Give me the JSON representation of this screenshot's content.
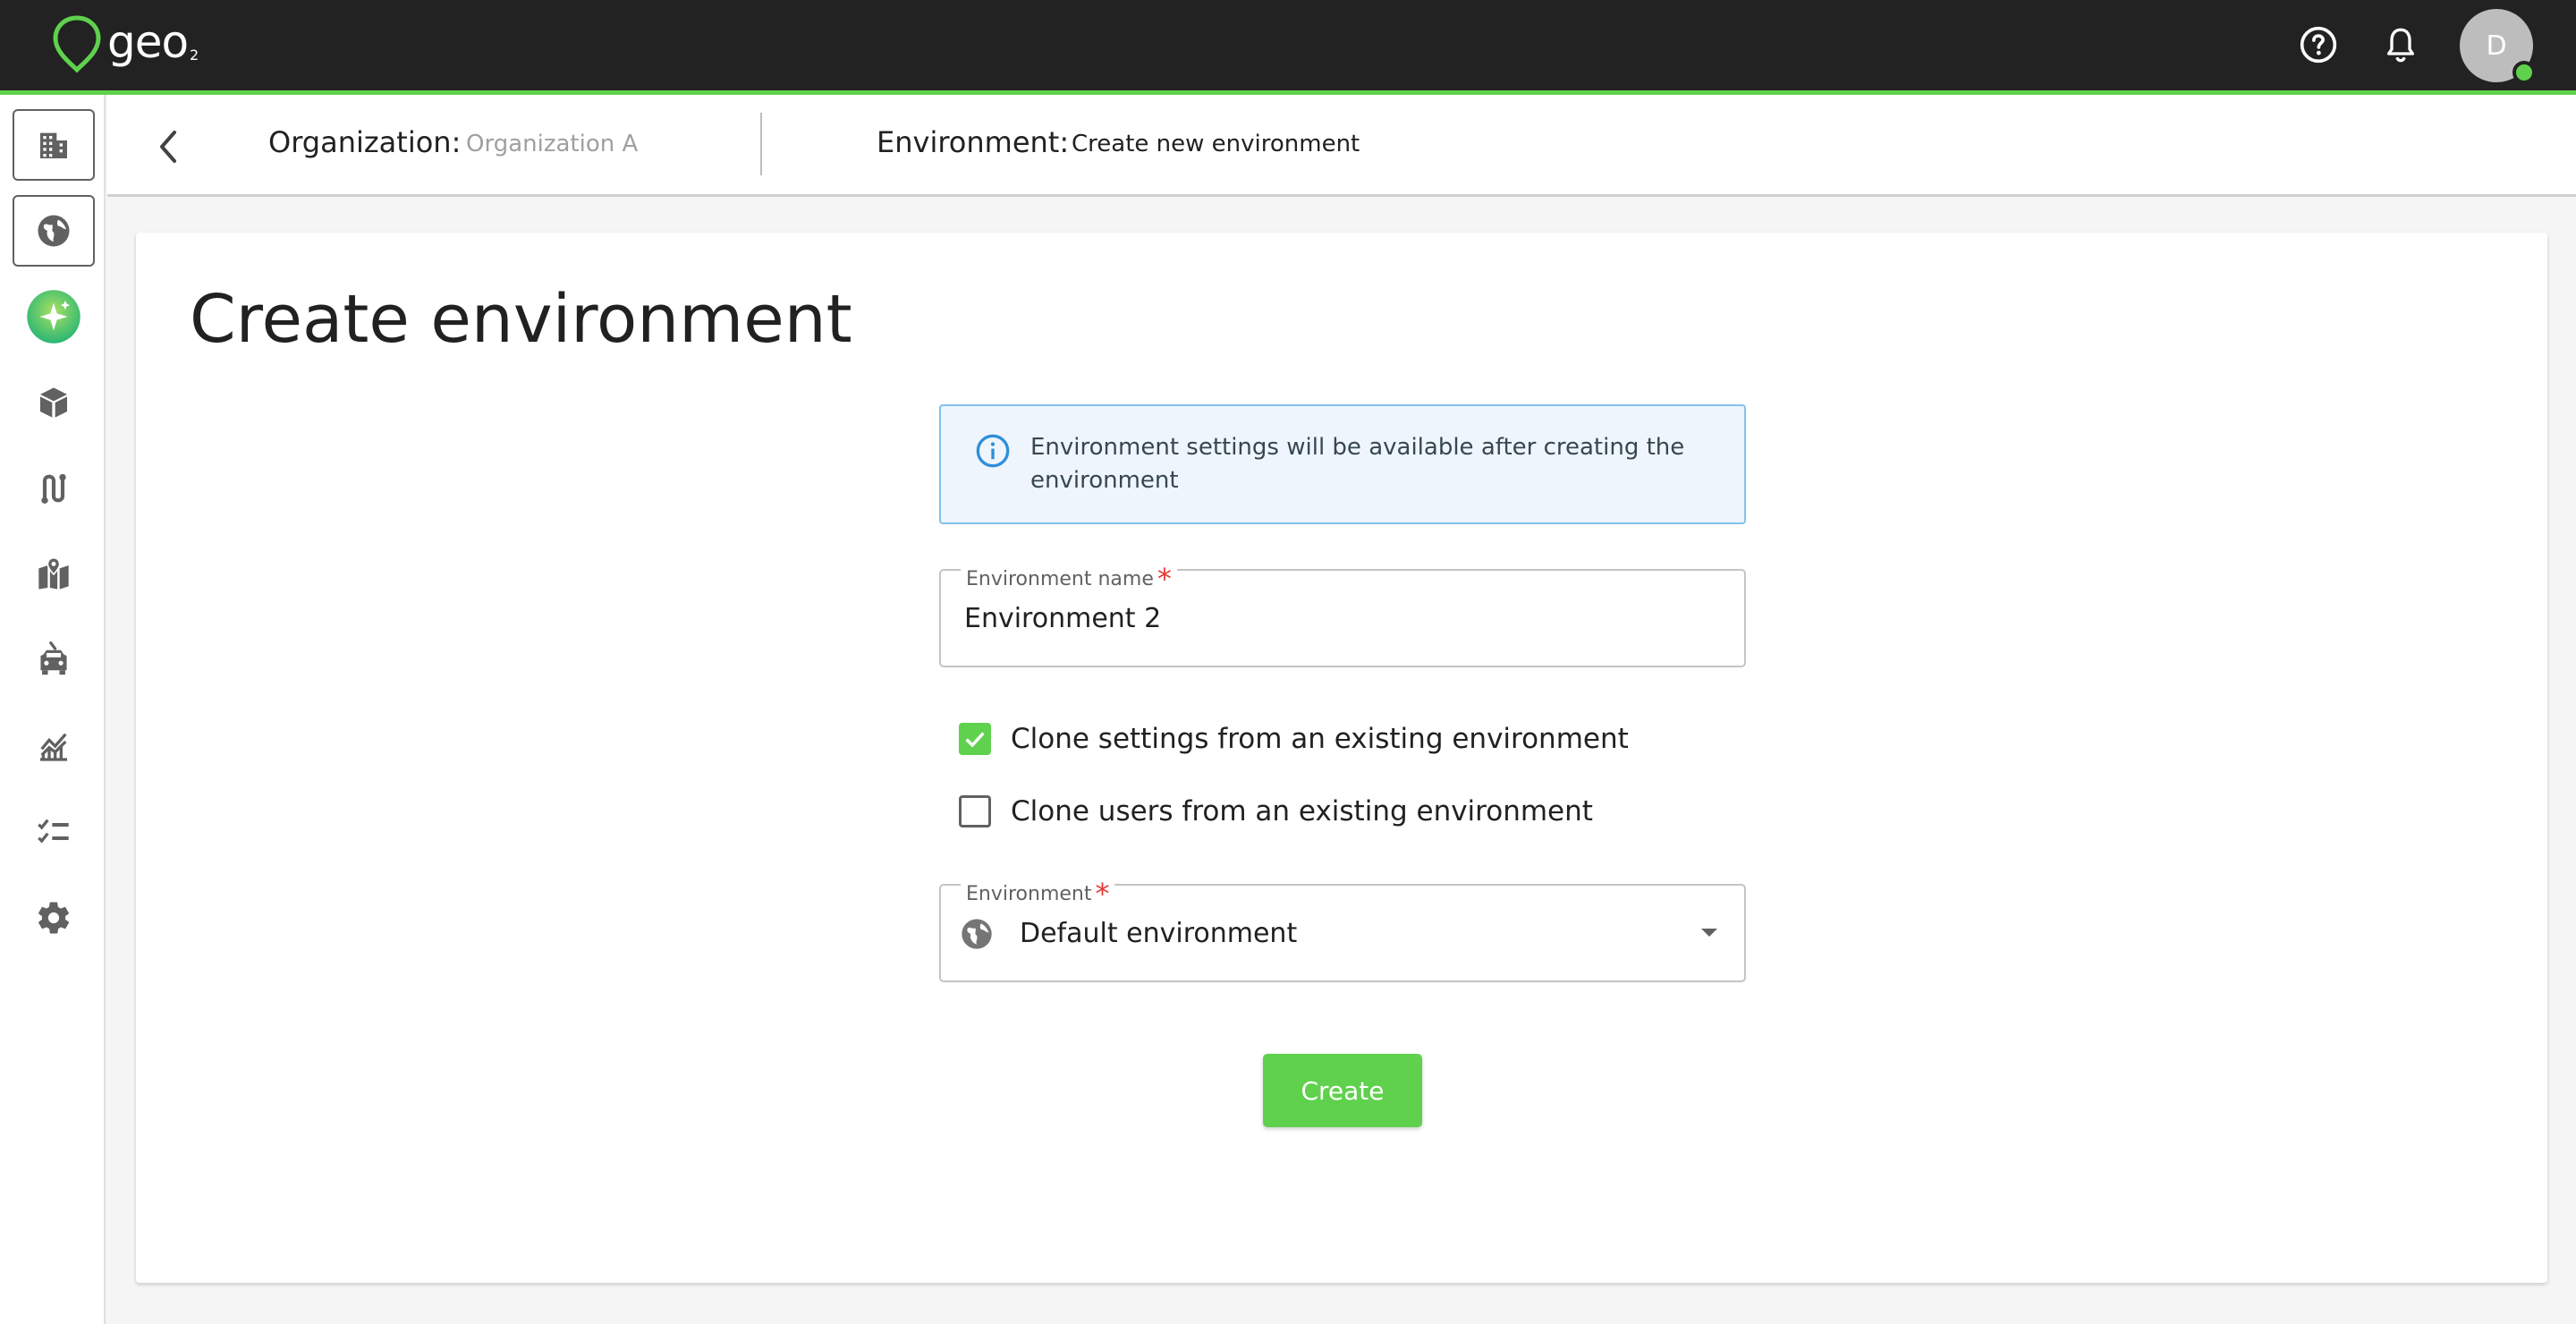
{
  "app": {
    "logo_text": "geo",
    "logo_sub": "2",
    "avatar_initial": "D",
    "brand_color": "#5fd14d"
  },
  "topbar": {
    "icons": [
      "help-icon",
      "bell-icon"
    ]
  },
  "sidebar": {
    "items": [
      {
        "icon": "organization-building-icon",
        "boxed": true
      },
      {
        "icon": "globe-icon",
        "boxed": true
      },
      {
        "icon": "magic-sparkle-icon",
        "boxed": false
      },
      {
        "icon": "package-box-icon",
        "boxed": false
      },
      {
        "icon": "route-icon",
        "boxed": false
      },
      {
        "icon": "map-pin-icon",
        "boxed": false
      },
      {
        "icon": "vehicle-icon",
        "boxed": false
      },
      {
        "icon": "analytics-chart-icon",
        "boxed": false
      },
      {
        "icon": "checklist-icon",
        "boxed": false
      },
      {
        "icon": "settings-gear-icon",
        "boxed": false
      }
    ]
  },
  "breadcrumb": {
    "organization_label": "Organization:",
    "organization_value": "Organization A",
    "environment_label": "Environment:",
    "environment_value": "Create new environment"
  },
  "main": {
    "title": "Create environment",
    "info_text": "Environment settings will be available after creating the environment",
    "name_field": {
      "label": "Environment name",
      "required_mark": "*",
      "value": "Environment 2"
    },
    "checkboxes": [
      {
        "label": "Clone settings from an existing environment",
        "checked": true
      },
      {
        "label": "Clone users from an existing environment",
        "checked": false
      }
    ],
    "environment_select": {
      "label": "Environment",
      "required_mark": "*",
      "value": "Default environment"
    },
    "create_button": "Create"
  }
}
